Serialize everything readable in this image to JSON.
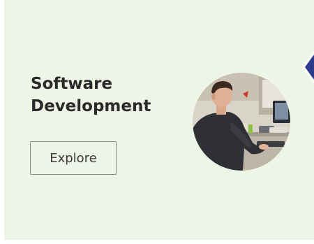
{
  "card": {
    "title_line1": "Software",
    "title_line2": "Development",
    "button_label": "Explore",
    "image_subject": "developer-at-desk-photo"
  },
  "colors": {
    "card_background": "#eef4e6",
    "title_text": "#2a2a2a",
    "button_border": "#8a8a8a",
    "nav_arrow": "#2e3a8c"
  },
  "icons": {
    "next": "chevron-right-icon"
  }
}
